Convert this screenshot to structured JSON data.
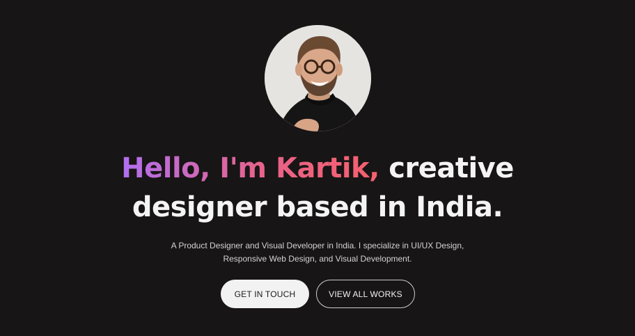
{
  "hero": {
    "headline_highlight": "Hello, I'm Kartik,",
    "headline_rest_line1": "creative",
    "headline_line2": "designer based in India.",
    "subtitle_line1": "A Product Designer and Visual Developer in India. I specialize in UI/UX Design,",
    "subtitle_line2": "Responsive Web Design, and Visual Development.",
    "primary_button": "GET IN TOUCH",
    "secondary_button": "VIEW ALL WORKS"
  },
  "colors": {
    "background": "#171515",
    "gradient_start": "#b06ff0",
    "gradient_end": "#f6606e",
    "button_primary_bg": "#f2f2f2"
  }
}
